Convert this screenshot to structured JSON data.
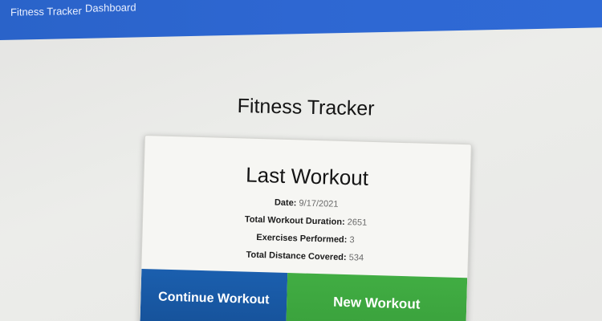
{
  "nav": {
    "brand": "Fitness Tracker",
    "links": [
      "Dashboard"
    ]
  },
  "page": {
    "title": "Fitness Tracker"
  },
  "card": {
    "title": "Last Workout",
    "stats": [
      {
        "label": "Date",
        "value": "9/17/2021"
      },
      {
        "label": "Total Workout Duration",
        "value": "2651"
      },
      {
        "label": "Exercises Performed",
        "value": "3"
      },
      {
        "label": "Total Distance Covered",
        "value": "534"
      }
    ],
    "buttons": {
      "continue": "Continue Workout",
      "new": "New Workout"
    }
  },
  "colors": {
    "navbar": "#2e67d2",
    "continue_button": "#16529a",
    "new_button": "#3da73f",
    "background": "#e9e9e7"
  }
}
